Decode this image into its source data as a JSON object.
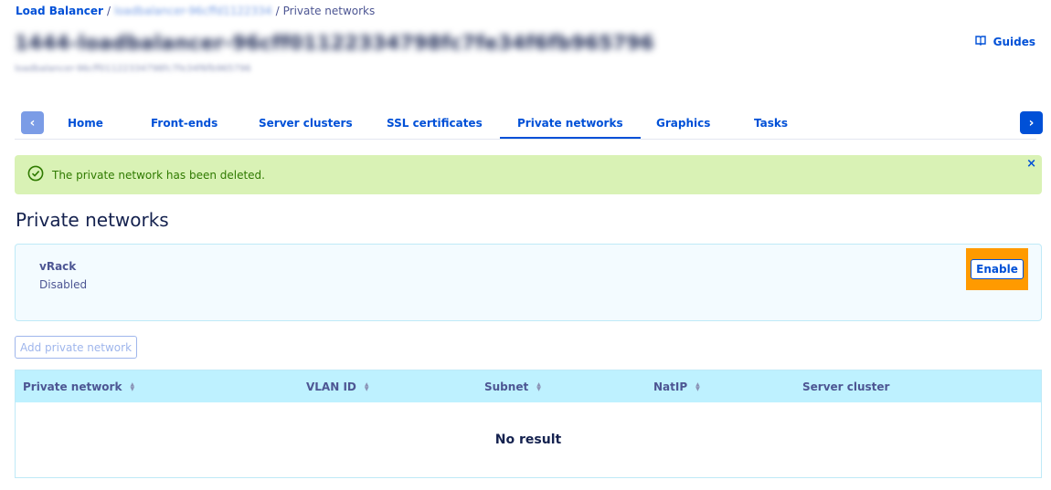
{
  "breadcrumb": {
    "root": "Load Balancer",
    "service": "loadbalancer-96cffd1122334",
    "current": "Private networks",
    "separator": "/"
  },
  "header": {
    "title": "1444-loadbalancer-96cff01122334798fc7fe34f6fb965796",
    "subtitle": "loadbalancer-96cff01122334798fc7fe34f6fb965796",
    "guides_label": "Guides",
    "guides_icon": "book-icon"
  },
  "tabs": [
    {
      "label": "Home"
    },
    {
      "label": "Front-ends"
    },
    {
      "label": "Server clusters"
    },
    {
      "label": "SSL certificates"
    },
    {
      "label": "Private networks",
      "active": true
    },
    {
      "label": "Graphics"
    },
    {
      "label": "Tasks"
    }
  ],
  "tab_arrows": {
    "left": "‹",
    "right": "›"
  },
  "alert": {
    "message": "The private network has been deleted.",
    "close": "×",
    "icon": "check-circle-icon"
  },
  "section": {
    "title": "Private networks"
  },
  "vrack": {
    "name": "vRack",
    "status": "Disabled",
    "enable_label": "Enable"
  },
  "add_button": "Add private network",
  "table": {
    "columns": [
      "Private network",
      "VLAN ID",
      "Subnet",
      "NatIP",
      "Server cluster"
    ],
    "empty": "No result"
  },
  "colors": {
    "accent": "#0050d7",
    "alert_bg": "#d9f2b5",
    "highlight": "#ff9a00",
    "table_header_bg": "#bef1ff"
  }
}
